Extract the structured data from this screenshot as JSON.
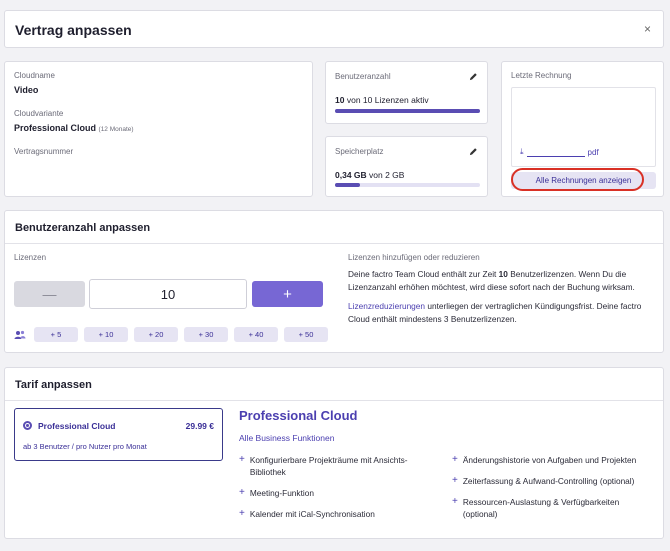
{
  "header": {
    "title": "Vertrag anpassen",
    "close_glyph": "×",
    "close_icon": "close-icon"
  },
  "info": {
    "cloudname_label": "Cloudname",
    "cloudname_value": "Video",
    "variant_label": "Cloudvariante",
    "variant_value": "Professional Cloud",
    "variant_duration": "(12 Monate)",
    "contract_label": "Vertragsnummer"
  },
  "users": {
    "label": "Benutzeranzahl",
    "count": "10",
    "text": "von 10 Lizenzen aktiv",
    "fill": 1.0,
    "edit_icon": "pencil-icon"
  },
  "storage": {
    "label": "Speicherplatz",
    "amount": "0,34 GB",
    "text": "von 2 GB",
    "fill": 0.17,
    "edit_icon": "pencil-icon"
  },
  "invoice": {
    "label": "Letzte Rechnung",
    "download_glyph": "⤓",
    "file_ext": "pdf",
    "show_all_label": "Alle Rechnungen anzeigen"
  },
  "adjust": {
    "title": "Benutzeranzahl anpassen",
    "licenses_label": "Lizenzen",
    "minus_glyph": "—",
    "plus_glyph": "+",
    "license_value": "10",
    "quick_add": [
      "+ 5",
      "+ 10",
      "+ 20",
      "+ 30",
      "+ 40",
      "+ 50"
    ],
    "right_label": "Lizenzen hinzufügen oder reduzieren",
    "para1_pre": "Deine factro Team Cloud enthält zur Zeit ",
    "para1_bold": "10",
    "para1_post": " Benutzerlizenzen. Wenn Du die Lizenzanzahl erhöhen möchtest, wird diese sofort nach der Buchung wirksam.",
    "para2_link": "Lizenzreduzierungen",
    "para2_post": " unterliegen der vertraglichen Kündigungsfrist. Deine factro Cloud enthält mindestens 3 Benutzerlizenzen."
  },
  "tarif": {
    "title": "Tarif anpassen",
    "plan": {
      "name": "Professional Cloud",
      "price": "29.99 €",
      "sub": "ab 3 Benutzer / pro Nutzer pro Monat"
    },
    "features_title": "Professional Cloud",
    "features_sub": "Alle Business Funktionen",
    "features_left": [
      "Konfigurierbare Projekträume mit Ansichts-Bibliothek",
      "Meeting-Funktion",
      "Kalender mit iCal-Synchronisation"
    ],
    "features_right": [
      "Änderungshistorie von Aufgaben und Projekten",
      "Zeiterfassung & Aufwand-Controlling (optional)",
      "Ressourcen-Auslastung & Verfügbarkeiten (optional)"
    ],
    "plus_glyph": "+"
  },
  "colors": {
    "accent": "#5a4db3",
    "accent_light": "#e6e4f3",
    "highlight": "#d93025"
  }
}
